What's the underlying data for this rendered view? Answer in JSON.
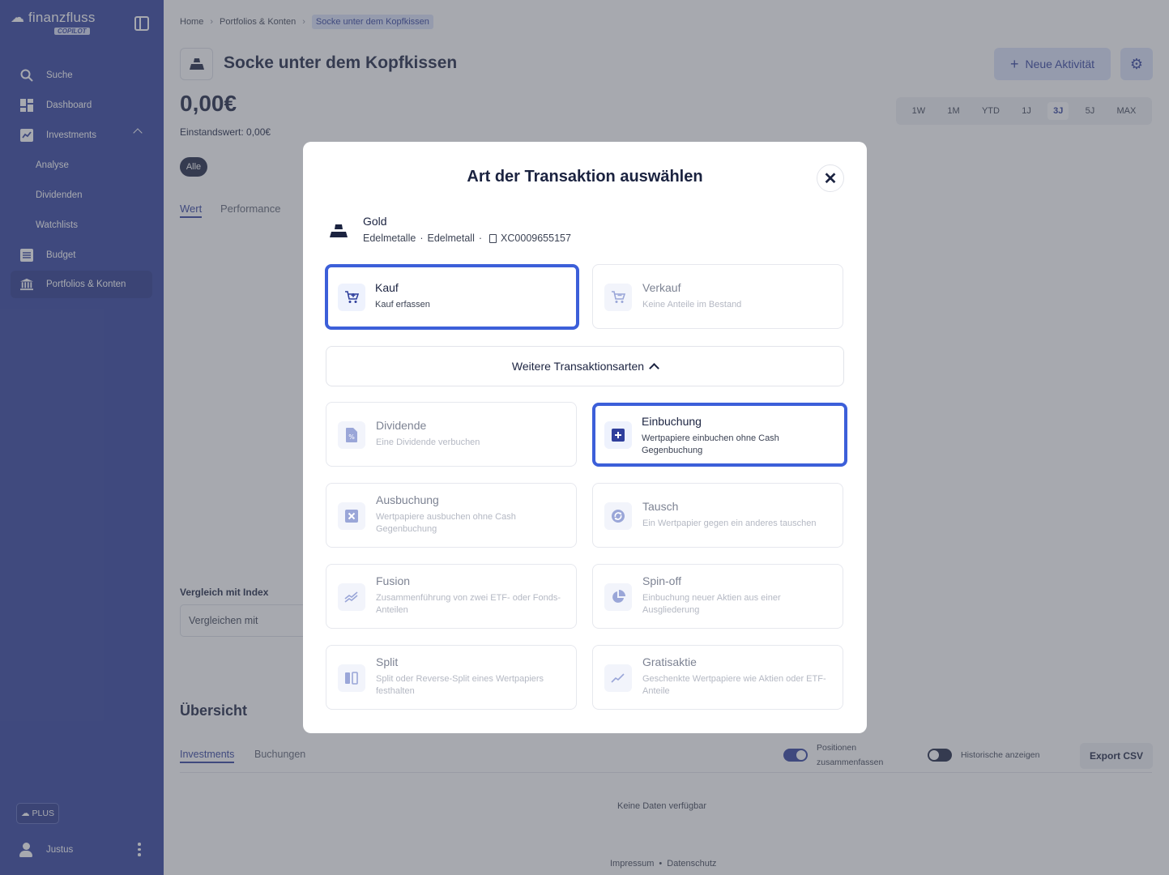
{
  "sidebar": {
    "logo_text": "finanzfluss",
    "logo_badge": "COPILOT",
    "items": [
      {
        "label": "Suche",
        "icon": "search-icon"
      },
      {
        "label": "Dashboard",
        "icon": "dashboard-icon"
      },
      {
        "label": "Investments",
        "icon": "chart-icon"
      },
      {
        "label": "Analyse"
      },
      {
        "label": "Dividenden"
      },
      {
        "label": "Watchlists"
      },
      {
        "label": "Budget",
        "icon": "budget-icon"
      },
      {
        "label": "Portfolios & Konten",
        "icon": "bank-icon"
      }
    ],
    "plus_label": "PLUS",
    "user_name": "Justus"
  },
  "breadcrumb": [
    "Home",
    "Portfolios & Konten",
    "Socke unter dem Kopfkissen"
  ],
  "header": {
    "title": "Socke unter dem Kopfkissen",
    "new_activity": "Neue Aktivität",
    "value": "0,00€",
    "einstandswert": "Einstandswert: 0,00€"
  },
  "ranges": [
    "1W",
    "1M",
    "YTD",
    "1J",
    "3J",
    "5J",
    "MAX"
  ],
  "active_range": "3J",
  "filter_chip": "Alle",
  "chart_tabs": [
    "Wert",
    "Performance"
  ],
  "vergleich": {
    "label": "Vergleich mit Index",
    "placeholder": "Vergleichen mit"
  },
  "overview": {
    "title": "Übersicht",
    "tabs": [
      "Investments",
      "Buchungen"
    ],
    "toggle_positions": "Positionen zusammenfassen",
    "toggle_history": "Historische anzeigen",
    "export": "Export CSV",
    "empty": "Keine Daten verfügbar"
  },
  "footer": {
    "impressum": "Impressum",
    "sep": "•",
    "datenschutz": "Datenschutz"
  },
  "modal": {
    "title": "Art der Transaktion auswählen",
    "asset_name": "Gold",
    "asset_category": "Edelmetalle",
    "asset_type": "Edelmetall",
    "asset_isin": "XC0009655157",
    "dot": "·",
    "more_types": "Weitere Transaktionsarten",
    "kauf": {
      "label": "Kauf",
      "desc": "Kauf erfassen"
    },
    "verkauf": {
      "label": "Verkauf",
      "desc": "Keine Anteile im Bestand"
    },
    "dividende": {
      "label": "Dividende",
      "desc": "Eine Dividende verbuchen"
    },
    "einbuchung": {
      "label": "Einbuchung",
      "desc": "Wertpapiere einbuchen ohne Cash Gegenbuchung"
    },
    "ausbuchung": {
      "label": "Ausbuchung",
      "desc": "Wertpapiere ausbuchen ohne Cash Gegenbuchung"
    },
    "tausch": {
      "label": "Tausch",
      "desc": "Ein Wertpapier gegen ein anderes tauschen"
    },
    "fusion": {
      "label": "Fusion",
      "desc": "Zusammenführung von zwei ETF- oder Fonds-Anteilen"
    },
    "spinoff": {
      "label": "Spin-off",
      "desc": "Einbuchung neuer Aktien aus einer Ausgliederung"
    },
    "split": {
      "label": "Split",
      "desc": "Split oder Reverse-Split eines Wertpapiers festhalten"
    },
    "gratisaktie": {
      "label": "Gratisaktie",
      "desc": "Geschenkte Wertpapiere wie Aktien oder ETF-Anteile"
    }
  },
  "colors": {
    "sidebar": "#2f3f9c",
    "accent": "#2f3f9c",
    "highlight": "#3c5fd9"
  }
}
